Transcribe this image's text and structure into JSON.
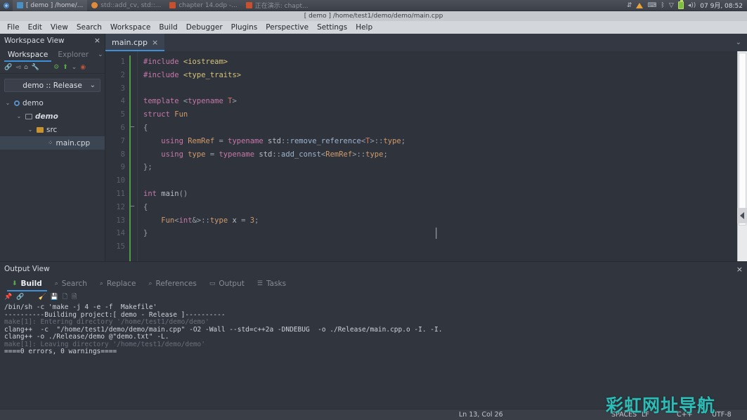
{
  "taskbar": {
    "start_icon": "start-menu-icon",
    "tasks": [
      {
        "icon": "window-icon",
        "label": "[ demo ] /home/...",
        "active": true
      },
      {
        "icon": "app-icon",
        "label": "std::add_cv, std::...",
        "active": false
      },
      {
        "icon": "impress-icon",
        "label": "chapter 14.odp -...",
        "active": false
      },
      {
        "icon": "impress-icon",
        "label": "正在演示: chapt...",
        "active": false
      }
    ],
    "tray": {
      "icons": [
        "network-icon",
        "warning-icon",
        "keyboard-icon",
        "bluetooth-icon",
        "wifi-icon",
        "battery-icon",
        "volume-icon"
      ],
      "clock": "07 9月, 08:52"
    }
  },
  "window": {
    "title": "[ demo ] /home/test1/demo/demo/main.cpp"
  },
  "menubar": {
    "items": [
      "File",
      "Edit",
      "View",
      "Search",
      "Workspace",
      "Build",
      "Debugger",
      "Plugins",
      "Perspective",
      "Settings",
      "Help"
    ]
  },
  "sidebar": {
    "title": "Workspace View",
    "close_label": "×",
    "tabs": [
      {
        "label": "Workspace",
        "active": true
      },
      {
        "label": "Explorer",
        "active": false
      }
    ],
    "tabs_caret": "⌄",
    "toolbar_icons": [
      "link-icon",
      "send-icon",
      "home-icon",
      "wrench-icon",
      "run-icon",
      "build-icon",
      "dropdown-icon",
      "stop-icon"
    ],
    "combo": {
      "value": "demo :: Release",
      "caret": "⌄"
    },
    "tree": [
      {
        "depth": 0,
        "twisty": "⌄",
        "icon": "workspace-dot-icon",
        "label": "demo",
        "style": "plain",
        "selected": false
      },
      {
        "depth": 1,
        "twisty": "⌄",
        "icon": "project-folder-icon",
        "label": "demo",
        "style": "bold-italic",
        "selected": false
      },
      {
        "depth": 2,
        "twisty": "⌄",
        "icon": "folder-icon",
        "label": "src",
        "style": "plain",
        "selected": false
      },
      {
        "depth": 3,
        "twisty": "",
        "icon": "cpp-file-icon",
        "label": "main.cpp",
        "style": "plain",
        "selected": true
      }
    ]
  },
  "editor": {
    "tab": {
      "label": "main.cpp",
      "close": "×"
    },
    "tabstrip_caret": "⌄",
    "line_numbers": [
      "1",
      "2",
      "3",
      "4",
      "5",
      "6",
      "7",
      "8",
      "9",
      "10",
      "11",
      "12",
      "13",
      "14",
      "15"
    ],
    "lines": [
      {
        "n": 1,
        "tokens": [
          {
            "t": "#include ",
            "c": "k"
          },
          {
            "t": "<iostream>",
            "c": "str"
          }
        ]
      },
      {
        "n": 2,
        "tokens": [
          {
            "t": "#include ",
            "c": "k"
          },
          {
            "t": "<type_traits>",
            "c": "str"
          }
        ]
      },
      {
        "n": 3,
        "tokens": []
      },
      {
        "n": 4,
        "tokens": [
          {
            "t": "template ",
            "c": "k"
          },
          {
            "t": "<",
            "c": "pn"
          },
          {
            "t": "typename ",
            "c": "k"
          },
          {
            "t": "T",
            "c": "tp"
          },
          {
            "t": ">",
            "c": "pn"
          }
        ]
      },
      {
        "n": 5,
        "tokens": [
          {
            "t": "struct ",
            "c": "k"
          },
          {
            "t": "Fun",
            "c": "ty"
          }
        ]
      },
      {
        "n": 6,
        "tokens": [
          {
            "t": "{",
            "c": "pn"
          }
        ],
        "fold": "−"
      },
      {
        "n": 7,
        "tokens": [
          {
            "t": "    using ",
            "c": "k"
          },
          {
            "t": "RemRef",
            "c": "ty"
          },
          {
            "t": " = ",
            "c": "pn"
          },
          {
            "t": "typename ",
            "c": "k"
          },
          {
            "t": "std",
            "c": "id"
          },
          {
            "t": "::",
            "c": "pn"
          },
          {
            "t": "remove_reference",
            "c": "fn"
          },
          {
            "t": "<",
            "c": "pn"
          },
          {
            "t": "T",
            "c": "tp"
          },
          {
            "t": ">::",
            "c": "pn"
          },
          {
            "t": "type",
            "c": "ty"
          },
          {
            "t": ";",
            "c": "pn"
          }
        ]
      },
      {
        "n": 8,
        "tokens": [
          {
            "t": "    using ",
            "c": "k"
          },
          {
            "t": "type",
            "c": "ty"
          },
          {
            "t": " = ",
            "c": "pn"
          },
          {
            "t": "typename ",
            "c": "k"
          },
          {
            "t": "std",
            "c": "id"
          },
          {
            "t": "::",
            "c": "pn"
          },
          {
            "t": "add_const",
            "c": "fn"
          },
          {
            "t": "<",
            "c": "pn"
          },
          {
            "t": "RemRef",
            "c": "ty"
          },
          {
            "t": ">::",
            "c": "pn"
          },
          {
            "t": "type",
            "c": "ty"
          },
          {
            "t": ";",
            "c": "pn"
          }
        ]
      },
      {
        "n": 9,
        "tokens": [
          {
            "t": "};",
            "c": "pn"
          }
        ]
      },
      {
        "n": 10,
        "tokens": []
      },
      {
        "n": 11,
        "tokens": [
          {
            "t": "int ",
            "c": "k"
          },
          {
            "t": "main",
            "c": "id"
          },
          {
            "t": "()",
            "c": "pn"
          }
        ]
      },
      {
        "n": 12,
        "tokens": [
          {
            "t": "{",
            "c": "pn"
          }
        ],
        "fold": "−"
      },
      {
        "n": 13,
        "tokens": [
          {
            "t": "    Fun",
            "c": "ty"
          },
          {
            "t": "<",
            "c": "pn"
          },
          {
            "t": "int",
            "c": "k"
          },
          {
            "t": "&>::",
            "c": "pn"
          },
          {
            "t": "type",
            "c": "ty"
          },
          {
            "t": " x ",
            "c": "id"
          },
          {
            "t": "= ",
            "c": "pn"
          },
          {
            "t": "3",
            "c": "num"
          },
          {
            "t": ";",
            "c": "pn"
          }
        ]
      },
      {
        "n": 14,
        "tokens": [
          {
            "t": "}",
            "c": "pn"
          }
        ]
      },
      {
        "n": 15,
        "tokens": []
      }
    ],
    "caret_marker": "|"
  },
  "output_view": {
    "title": "Output View",
    "close_label": "×",
    "tabs": [
      {
        "label": "Build",
        "icon": "build-icon",
        "active": true
      },
      {
        "label": "Search",
        "icon": "search-icon",
        "active": false
      },
      {
        "label": "Replace",
        "icon": "replace-icon",
        "active": false
      },
      {
        "label": "References",
        "icon": "references-icon",
        "active": false
      },
      {
        "label": "Output",
        "icon": "output-icon",
        "active": false
      },
      {
        "label": "Tasks",
        "icon": "tasks-icon",
        "active": false
      }
    ],
    "toolbar_icons": [
      "pin-icon",
      "link-icon",
      "clear-icon",
      "save-icon",
      "copy-icon",
      "copy-all-icon"
    ],
    "log_lines": [
      {
        "text": "/bin/sh -c 'make -j 4 -e -f  Makefile'",
        "dim": false
      },
      {
        "text": "----------Building project:[ demo - Release ]----------",
        "dim": false
      },
      {
        "text": "make[1]: Entering directory '/home/test1/demo/demo'",
        "dim": true
      },
      {
        "text": "clang++  -c  \"/home/test1/demo/demo/main.cpp\" -O2 -Wall --std=c++2a -DNDEBUG  -o ./Release/main.cpp.o -I. -I.",
        "dim": false
      },
      {
        "text": "clang++ -o ./Release/demo @\"demo.txt\" -L.",
        "dim": false
      },
      {
        "text": "make[1]: Leaving directory '/home/test1/demo/demo'",
        "dim": true
      },
      {
        "text": "====0 errors, 0 warnings====",
        "dim": false
      }
    ]
  },
  "statusbar": {
    "position": "Ln 13, Col 26",
    "indent": "SPACES",
    "eol": "LF",
    "language": "C++",
    "encoding": "UTF-8"
  },
  "watermark": {
    "text": "彩虹网址导航",
    "color": "#2bbdb6"
  },
  "colors": {
    "accent": "#3f8fd6",
    "editor_bg": "#2f333c",
    "panel_bg": "#31353e",
    "menubar_bg": "#d3d6da"
  }
}
